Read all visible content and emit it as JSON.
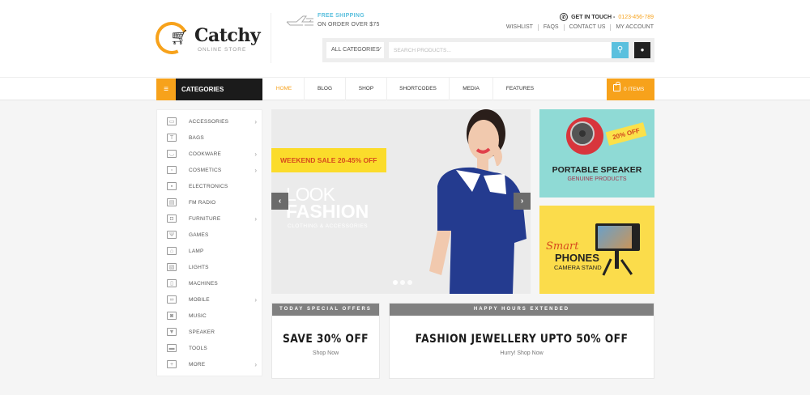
{
  "header": {
    "logo": {
      "name": "Catchy",
      "tagline": "ONLINE STORE",
      "icon": "cart-icon"
    },
    "shipping": {
      "title": "FREE SHIPPING",
      "subtitle": "ON ORDER OVER $75",
      "icon": "airplane-icon"
    },
    "contact": {
      "label": "GET IN TOUCH -",
      "phone": "0123-456-789",
      "icon": "phone-icon"
    },
    "top_links": [
      "WISHLIST",
      "FAQS",
      "CONTACT US",
      "MY ACCOUNT"
    ],
    "search": {
      "category_selected": "ALL CATEGORIES",
      "placeholder": "SEARCH PRODUCTS...",
      "search_icon": "search-icon",
      "user_icon": "user-icon"
    }
  },
  "nav": {
    "categories_label": "CATEGORIES",
    "menu_icon": "hamburger-icon",
    "items": [
      {
        "label": "HOME",
        "active": true
      },
      {
        "label": "BLOG",
        "active": false
      },
      {
        "label": "SHOP",
        "active": false
      },
      {
        "label": "SHORTCODES",
        "active": false
      },
      {
        "label": "MEDIA",
        "active": false
      },
      {
        "label": "FEATURES",
        "active": false
      }
    ],
    "cart": {
      "label": "0 ITEMS",
      "icon": "shopping-bag-icon"
    }
  },
  "sidebar": {
    "items": [
      {
        "label": "ACCESSORIES",
        "icon": "monitor-icon",
        "glyph": "▭",
        "has_sub": true
      },
      {
        "label": "BAGS",
        "icon": "tshirt-icon",
        "glyph": "T",
        "has_sub": false
      },
      {
        "label": "COOKWARE",
        "icon": "pot-icon",
        "glyph": "◡",
        "has_sub": true
      },
      {
        "label": "COSMETICS",
        "icon": "wallet-icon",
        "glyph": "▫",
        "has_sub": true
      },
      {
        "label": "ELECTRONICS",
        "icon": "appliance-icon",
        "glyph": "▪",
        "has_sub": false
      },
      {
        "label": "FM RADIO",
        "icon": "sofa-icon",
        "glyph": "▤",
        "has_sub": false
      },
      {
        "label": "FURNITURE",
        "icon": "gamepad-icon",
        "glyph": "◘",
        "has_sub": true
      },
      {
        "label": "GAMES",
        "icon": "lamp-stand-icon",
        "glyph": "Ψ",
        "has_sub": false
      },
      {
        "label": "LAMP",
        "icon": "ceiling-lamp-icon",
        "glyph": "⌂",
        "has_sub": false
      },
      {
        "label": "LIGHTS",
        "icon": "picture-icon",
        "glyph": "▧",
        "has_sub": false
      },
      {
        "label": "MACHINES",
        "icon": "flashlight-icon",
        "glyph": "▯",
        "has_sub": false
      },
      {
        "label": "MOBILE",
        "icon": "earbuds-icon",
        "glyph": "∞",
        "has_sub": true
      },
      {
        "label": "MUSIC",
        "icon": "speaker-icon",
        "glyph": "◙",
        "has_sub": false
      },
      {
        "label": "SPEAKER",
        "icon": "hairdryer-icon",
        "glyph": "▼",
        "has_sub": false
      },
      {
        "label": "TOOLS",
        "icon": "toolbox-icon",
        "glyph": "▬",
        "has_sub": false
      },
      {
        "label": "MORE",
        "icon": "plus-box-icon",
        "glyph": "+",
        "has_sub": true
      }
    ],
    "arrow": "›"
  },
  "slider": {
    "sale_tag": "WEEKEND SALE 20-45% OFF",
    "headline_1": "LOOK",
    "headline_2": "FASHION",
    "subline": "CLOTHING & ACCESSORIES",
    "prev": "‹",
    "next": "›",
    "slide_count": 3,
    "active_slide": 1
  },
  "banners": [
    {
      "title": "PORTABLE SPEAKER",
      "subtitle": "GENUINE PRODUCTS",
      "badge": "20% OFF",
      "bg": "#8fdad5"
    },
    {
      "script": "Smart",
      "title": "PHONES",
      "subtitle": "CAMERA STAND",
      "bg": "#fbdc4b"
    }
  ],
  "offers": [
    {
      "header": "TODAY SPECIAL OFFERS",
      "title": "SAVE 30% OFF",
      "link": "Shop Now"
    },
    {
      "header": "HAPPY HOURS EXTENDED",
      "title": "FASHION JEWELLERY UPTO 50% OFF",
      "link": "Hurry! Shop Now"
    }
  ],
  "colors": {
    "accent": "#f7a21b",
    "search": "#5bc0de",
    "dark": "#1b1b1b",
    "sale_tag": "#fbdc2b"
  }
}
